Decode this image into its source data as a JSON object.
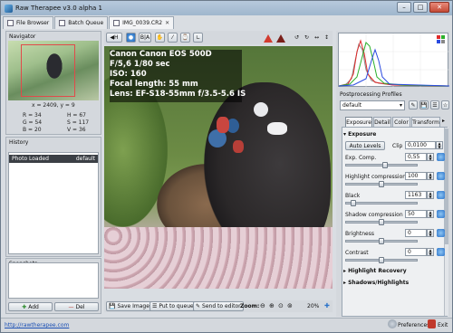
{
  "window": {
    "title": "Raw Therapee v3.0 alpha 1"
  },
  "tabs": [
    {
      "label": "File Browser"
    },
    {
      "label": "Batch Queue"
    },
    {
      "label": "IMG_0039.CR2"
    }
  ],
  "navigator": {
    "title": "Navigator",
    "coords": "x = 2409, y = 9",
    "r": "R = 34",
    "g": "G = 54",
    "b": "B = 20",
    "h": "H = 67",
    "s": "S = 117",
    "v": "V = 36"
  },
  "history": {
    "title": "History",
    "items": [
      {
        "label": "Photo Loaded",
        "value": "default"
      }
    ]
  },
  "snapshots": {
    "title": "Snapshots",
    "add_label": "Add",
    "del_label": "Del"
  },
  "toolbar": {
    "ba_label": "B|A"
  },
  "exif": {
    "camera": "Canon Canon EOS 500D",
    "exposure": "F/5,6 1/80 sec",
    "iso": "ISO: 160",
    "focal": "Focal length: 55 mm",
    "lens": "Lens: EF-S18-55mm f/3.5-5.6 IS"
  },
  "bottombar": {
    "save_label": "Save Image",
    "queue_label": "Put to queue",
    "editor_label": "Send to editor",
    "zoom_label": "Zoom:",
    "zoom_value": "20%"
  },
  "status": {
    "link": "http://rawtherapee.com",
    "preferences": "Preferences",
    "exit": "Exit"
  },
  "profiles": {
    "title": "Postprocessing Profiles",
    "selected": "default"
  },
  "tool_tabs": [
    {
      "label": "Exposure",
      "active": true
    },
    {
      "label": "Detail"
    },
    {
      "label": "Color"
    },
    {
      "label": "Transform"
    }
  ],
  "exposure": {
    "title": "Exposure",
    "auto_levels": "Auto Levels",
    "clip_label": "Clip",
    "clip_value": "0,0100",
    "controls": [
      {
        "label": "Exp. Comp.",
        "value": "0,55",
        "fraction": 0.55
      },
      {
        "label": "Highlight compression",
        "value": "100",
        "fraction": 0.5
      },
      {
        "label": "Black",
        "value": "1163",
        "fraction": 0.08
      },
      {
        "label": "Shadow compression",
        "value": "50",
        "fraction": 0.5
      },
      {
        "label": "Brightness",
        "value": "0",
        "fraction": 0.5
      },
      {
        "label": "Contrast",
        "value": "0",
        "fraction": 0.5
      }
    ]
  },
  "sections": {
    "highlight_recovery": "Highlight Recovery",
    "shadows_highlights": "Shadows/Highlights"
  },
  "colors": {
    "accent": "#2b73c9",
    "warning": "#d23b2f"
  }
}
